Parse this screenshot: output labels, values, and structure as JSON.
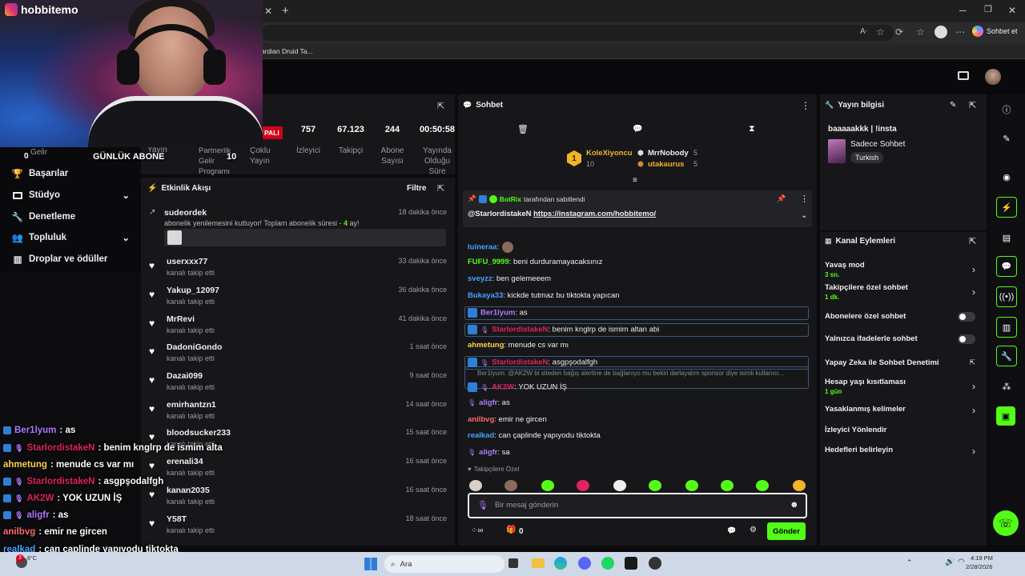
{
  "browser": {
    "bookmark": "ardian Druid Ta...",
    "copilot_label": "Sohbet et"
  },
  "overlay": {
    "channel": "hobbitemo",
    "daily_sub_label": "GÜNLÜK ABONE",
    "daily_sub_count": "10",
    "sub_left_count": "0",
    "chat": [
      {
        "user": "Ber1lyum",
        "text": ": as",
        "color": "#b07bff"
      },
      {
        "user": "StarlordistakeN",
        "text": ": benim knglrp de ismim alta",
        "color": "#e0245e"
      },
      {
        "user": "ahmetung",
        "text": ": menude cs var mı",
        "color": "#ffd24a"
      },
      {
        "user": "StarlordistakeN",
        "text": ": asgpşodalfgh",
        "color": "#e0245e"
      },
      {
        "user": "AK2W",
        "text": ": YOK UZUN İŞ",
        "color": "#e0245e"
      },
      {
        "user": "aligfr",
        "text": ": as",
        "color": "#b07bff"
      },
      {
        "user": "anilbvg",
        "text": ": emir ne gircen",
        "color": "#ff6a6a"
      },
      {
        "user": "realkad",
        "text": ": can çaplinde yapıyodu tiktokta",
        "color": "#4aa0ff"
      },
      {
        "user": "aligfr",
        "text": ": sa",
        "color": "#b07bff"
      }
    ]
  },
  "leftnav": {
    "partial_income": "Gelir",
    "items": [
      {
        "label": "Başarılar",
        "icon": "trophy-icon",
        "chev": false
      },
      {
        "label": "Stüdyo",
        "icon": "studio-icon",
        "chev": true
      },
      {
        "label": "Denetleme",
        "icon": "wrench-icon",
        "chev": false
      },
      {
        "label": "Topluluk",
        "icon": "community-icon",
        "chev": true
      },
      {
        "label": "Droplar ve ödüller",
        "icon": "drops-icon",
        "chev": false
      }
    ]
  },
  "stats": {
    "status": "PALI",
    "viewers": "757",
    "viewers_label": "İzleyici",
    "followers": "67.123",
    "followers_label": "Takipçi",
    "subs": "244",
    "subs_label": "Abone Sayısı",
    "uptime": "00:50:58",
    "uptime_label": "Yayında Olduğu Süre",
    "partial_labels": [
      "Yayın",
      "Partnerlik Gelir Programı",
      "Çoklu Yayın"
    ]
  },
  "feed": {
    "title": "Etkinlik Akışı",
    "filter": "Filtre",
    "top": {
      "user": "sudeordek",
      "text": "abonelik yenilemesini kutluyor! Toplam abonelik süresi - ",
      "months": "4",
      "suffix": " ay!",
      "time": "18 dakika önce"
    },
    "items": [
      {
        "user": "userxxx77",
        "action": "kanalı takip etti",
        "time": "33 dakika önce"
      },
      {
        "user": "Yakup_12097",
        "action": "kanalı takip etti",
        "time": "36 dakika önce"
      },
      {
        "user": "MrRevi",
        "action": "kanalı takip etti",
        "time": "41 dakika önce"
      },
      {
        "user": "DadoniGondo",
        "action": "kanalı takip etti",
        "time": "1 saat önce"
      },
      {
        "user": "Dazai099",
        "action": "kanalı takip etti",
        "time": "9 saat önce"
      },
      {
        "user": "emirhantzn1",
        "action": "kanalı takip etti",
        "time": "14 saat önce"
      },
      {
        "user": "bloodsucker233",
        "action": "kanalı takip etti",
        "time": "15 saat önce"
      },
      {
        "user": "erenali34",
        "action": "kanalı takip etti",
        "time": "16 saat önce"
      },
      {
        "user": "kanan2035",
        "action": "kanalı takip etti",
        "time": "16 saat önce"
      },
      {
        "user": "Y58T",
        "action": "kanalı takip etti",
        "time": "18 saat önce"
      }
    ]
  },
  "chat": {
    "title": "Sohbet",
    "top_gifters": {
      "first": "KoleXiyoncu",
      "first_count": "10",
      "second": "MrrNobody",
      "second_count": "5",
      "third": "utakaurus",
      "third_count": "5"
    },
    "pinned_by": "tarafından sabitlendi",
    "pinned_user": "BotRix",
    "pinned_msg": "@StarlordistakeN ",
    "pinned_link": "https://instagram.com/hobbitemo/",
    "messages": [
      {
        "user": "luineraa",
        "text": ":",
        "color": "#4aa0ff"
      },
      {
        "user": "FUFU_9999",
        "text": ": beni durduramayacaksınız",
        "color": "#53fc18"
      },
      {
        "user": "sveyzz",
        "text": ": ben gelemeeem",
        "color": "#4aa0ff"
      },
      {
        "user": "Bukaya33",
        "text": ": kickde tutmaz bu tiktokta yapıcan",
        "color": "#4aa0ff"
      },
      {
        "user": "Ber1lyum",
        "text": ": as",
        "color": "#b07bff"
      },
      {
        "user": "StarlordistakeN",
        "text": ": benim knglrp de ismim altan abi",
        "color": "#e0245e"
      },
      {
        "user": "ahmetung",
        "text": ": menude cs var mı",
        "color": "#ffd24a"
      },
      {
        "user": "StarlordistakeN",
        "text": ": asgpşodalfgh",
        "color": "#e0245e"
      },
      {
        "user": "AK2W",
        "text": ": YOK UZUN İŞ",
        "color": "#e0245e"
      },
      {
        "user": "aligfr",
        "text": ": as",
        "color": "#b07bff"
      },
      {
        "user": "anilbvg",
        "text": ": emir ne gircen",
        "color": "#ff6a6a"
      },
      {
        "user": "realkad",
        "text": ": can çaplinde yapıyodu tiktokta",
        "color": "#4aa0ff"
      },
      {
        "user": "aligfr",
        "text": ": sa",
        "color": "#b07bff"
      }
    ],
    "reply_preview": "Ber1lyum: @AK2W bi siteden bağış alertine de bağlanıyo mu bekiri darlayalım sponsor diye isimli kullanıcı...",
    "emote_section": "Takipçilere Özel",
    "input_placeholder": "Bir mesaj gönderin",
    "points": "0",
    "send": "Gönder"
  },
  "info": {
    "title": "Yayın bilgisi",
    "stream_title": "baaaaakkk | !insta",
    "category": "Sadece Sohbet",
    "language": "Turkish"
  },
  "actions": {
    "title": "Kanal Eylemleri",
    "rows": [
      {
        "label": "Yavaş mod",
        "sub": "3 sn.",
        "kind": "chev"
      },
      {
        "label": "Takipçilere özel sohbet",
        "sub": "1 dk.",
        "kind": "chev"
      },
      {
        "label": "Abonelere özel sohbet",
        "sub": "",
        "kind": "toggle"
      },
      {
        "label": "Yalnızca ifadelerle sohbet",
        "sub": "",
        "kind": "toggle"
      },
      {
        "label": "Yapay Zeka ile Sohbet Denetimi",
        "sub": "",
        "kind": "ext"
      },
      {
        "label": "Hesap yaşı kısıtlaması",
        "sub": "1 gün",
        "kind": "chev"
      },
      {
        "label": "Yasaklanmış kelimeler",
        "sub": "",
        "kind": "chev"
      },
      {
        "label": "İzleyici Yönlendir",
        "sub": "",
        "kind": "none"
      },
      {
        "label": "Hedefleri belirleyin",
        "sub": "",
        "kind": "chev"
      }
    ]
  },
  "taskbar": {
    "search": "Ara",
    "temp": "8°C",
    "time": "4:19 PM",
    "date": "2/28/2026",
    "notif": "3"
  }
}
